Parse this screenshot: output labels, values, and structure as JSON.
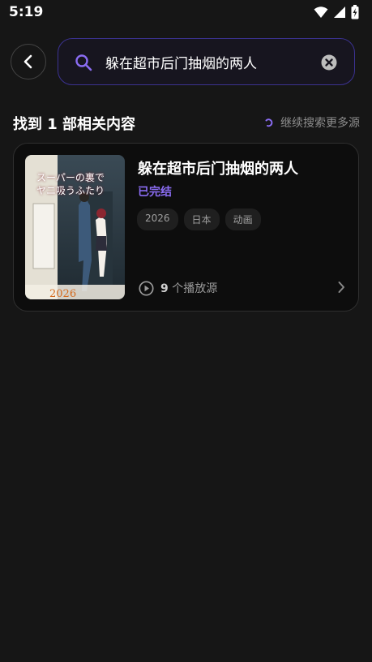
{
  "status_bar": {
    "time": "5:19"
  },
  "search": {
    "query": "躲在超市后门抽烟的两人"
  },
  "results_header": {
    "title": "找到 1 部相关内容",
    "more_sources": "继续搜索更多源"
  },
  "result": {
    "title": "躲在超市后门抽烟的两人",
    "status": "已完结",
    "tags": [
      "2026",
      "日本",
      "动画"
    ],
    "source_count": "9",
    "source_suffix": " 个播放源",
    "poster_texts": {
      "headline_1": "スーパーの裏で",
      "headline_2": "ヤニ吸うふたり",
      "year": "2026"
    }
  },
  "colors": {
    "accent": "#8a6cf2",
    "background": "#161616",
    "card": "#0d0d0d"
  }
}
